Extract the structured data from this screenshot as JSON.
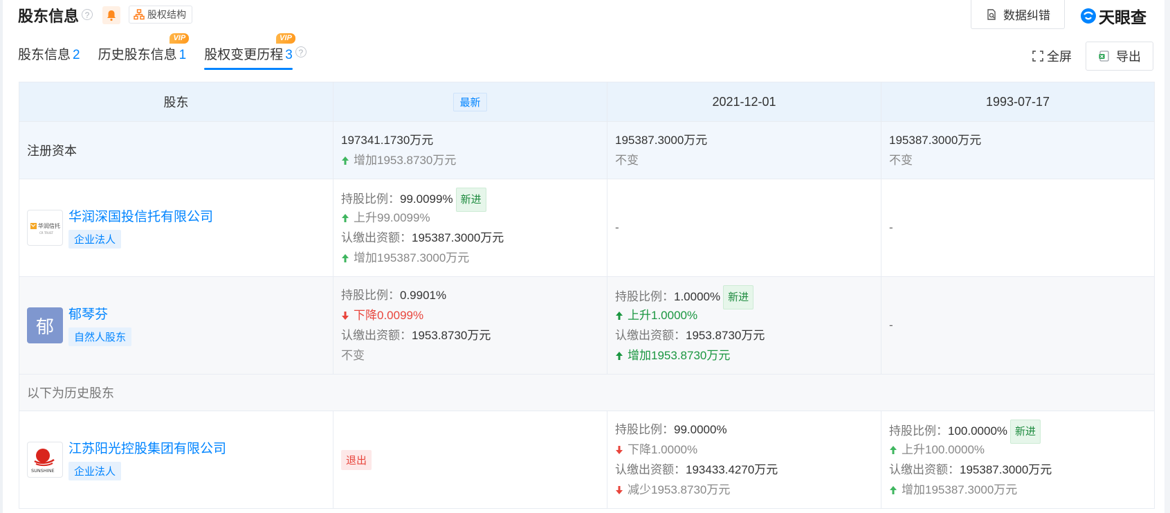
{
  "header": {
    "title": "股东信息",
    "help_glyph": "?",
    "struct_label": "股权结构",
    "correct_label": "数据纠错",
    "logo_text": "天眼查"
  },
  "tabs": [
    {
      "label": "股东信息",
      "count": "2",
      "vip": ""
    },
    {
      "label": "历史股东信息",
      "count": "1",
      "vip": "VIP"
    },
    {
      "label": "股权变更历程",
      "count": "3",
      "vip": "VIP"
    }
  ],
  "toolbar": {
    "fullscreen_label": "全屏",
    "export_label": "导出"
  },
  "table": {
    "col_holder": "股东",
    "col_latest": "最新",
    "col_date1": "2021-12-01",
    "col_date2": "1993-07-17",
    "capital": {
      "label": "注册资本",
      "latest_value": "197341.1730万元",
      "latest_change": "增加1953.8730万元",
      "date1_value": "195387.3000万元",
      "date1_change": "不变",
      "date2_value": "195387.3000万元",
      "date2_change": "不变"
    },
    "ratio_label": "持股比例：",
    "paid_label": "认缴出资额：",
    "new_badge": "新进",
    "dash": "-",
    "history_label": "以下为历史股东",
    "rows": [
      {
        "name": "华润深国投信托有限公司",
        "tag": "企业法人",
        "logo_text": "华润信托",
        "logo_sub": "CR TRUST",
        "latest": {
          "ratio": "99.0099%",
          "ratio_change": "上升99.0099%",
          "paid": "195387.3000万元",
          "paid_change": "增加195387.3000万元"
        }
      },
      {
        "name": "郁琴芬",
        "tag": "自然人股东",
        "avatar_char": "郁",
        "latest": {
          "ratio": "0.9901%",
          "ratio_change": "下降0.0099%",
          "paid": "1953.8730万元",
          "paid_change": "不变"
        },
        "date1": {
          "ratio": "1.0000%",
          "ratio_change": "上升1.0000%",
          "paid": "1953.8730万元",
          "paid_change": "增加1953.8730万元"
        }
      },
      {
        "name": "江苏阳光控股集团有限公司",
        "tag": "企业法人",
        "logo_text": "SUNSHINE",
        "latest_exit": "退出",
        "date1": {
          "ratio": "99.0000%",
          "ratio_change": "下降1.0000%",
          "paid": "193433.4270万元",
          "paid_change": "减少1953.8730万元"
        },
        "date2": {
          "ratio": "100.0000%",
          "ratio_change": "上升100.0000%",
          "paid": "195387.3000万元",
          "paid_change": "增加195387.3000万元"
        }
      }
    ]
  },
  "colors": {
    "accent": "#0084ff",
    "up_green": "#1a9640",
    "down_red": "#e8453c",
    "header_bg": "#eaf3fc",
    "avatar_bg": "#7f97cf"
  }
}
